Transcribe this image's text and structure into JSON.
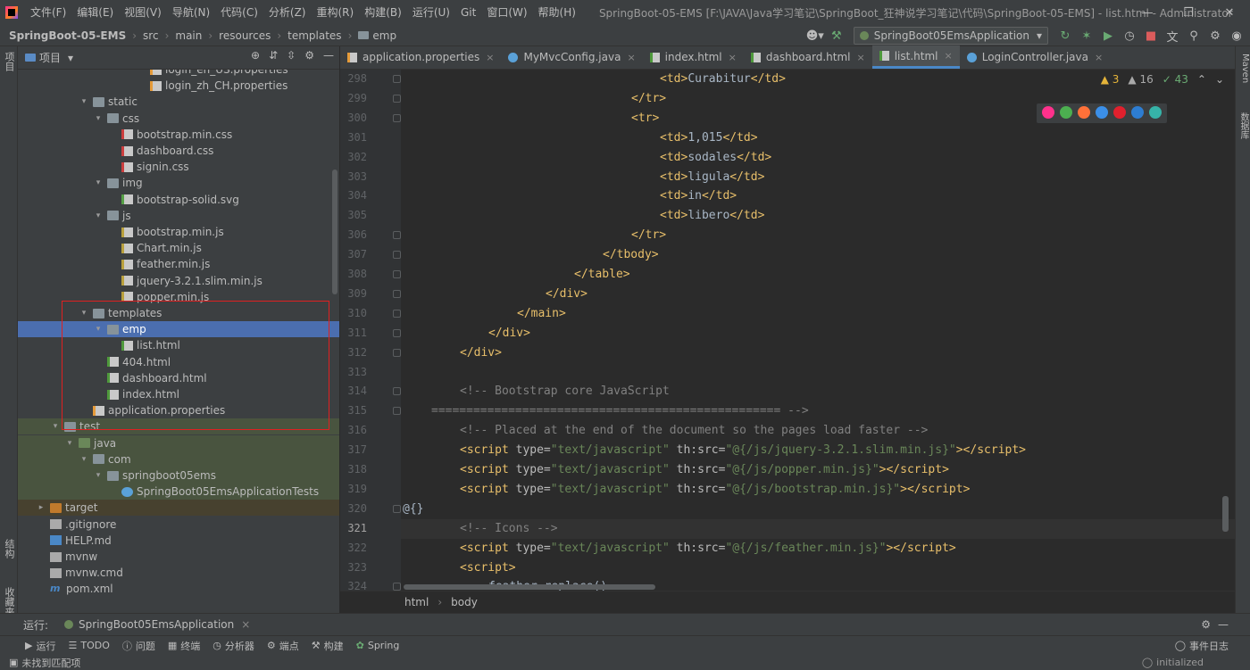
{
  "menu": {
    "items": [
      "文件(F)",
      "编辑(E)",
      "视图(V)",
      "导航(N)",
      "代码(C)",
      "分析(Z)",
      "重构(R)",
      "构建(B)",
      "运行(U)",
      "Git",
      "窗口(W)",
      "帮助(H)"
    ],
    "window_title": "SpringBoot-05-EMS [F:\\JAVA\\Java学习笔记\\SpringBoot_狂神说学习笔记\\代码\\SpringBoot-05-EMS] - list.html - Administrator"
  },
  "nav": {
    "breadcrumbs": [
      "SpringBoot-05-EMS",
      "src",
      "main",
      "resources",
      "templates",
      "emp"
    ],
    "run_config": "SpringBoot05EmsApplication"
  },
  "left_stripe": {
    "project": "项目",
    "structure": "结构",
    "favorites": "收藏夹"
  },
  "project_panel": {
    "title": "项目",
    "tree": [
      {
        "label": "login_en_US.properties",
        "type": "props"
      },
      {
        "label": "login_zh_CH.properties",
        "type": "props"
      },
      {
        "label": "static",
        "type": "folder",
        "expanded": true
      },
      {
        "label": "css",
        "type": "folder",
        "expanded": true
      },
      {
        "label": "bootstrap.min.css",
        "type": "css"
      },
      {
        "label": "dashboard.css",
        "type": "css"
      },
      {
        "label": "signin.css",
        "type": "css"
      },
      {
        "label": "img",
        "type": "folder",
        "expanded": true
      },
      {
        "label": "bootstrap-solid.svg",
        "type": "svg"
      },
      {
        "label": "js",
        "type": "folder",
        "expanded": true
      },
      {
        "label": "bootstrap.min.js",
        "type": "js"
      },
      {
        "label": "Chart.min.js",
        "type": "js"
      },
      {
        "label": "feather.min.js",
        "type": "js"
      },
      {
        "label": "jquery-3.2.1.slim.min.js",
        "type": "js"
      },
      {
        "label": "popper.min.js",
        "type": "js"
      },
      {
        "label": "templates",
        "type": "folder",
        "expanded": true
      },
      {
        "label": "emp",
        "type": "folder",
        "expanded": true,
        "selected": true
      },
      {
        "label": "list.html",
        "type": "html"
      },
      {
        "label": "404.html",
        "type": "html"
      },
      {
        "label": "dashboard.html",
        "type": "html"
      },
      {
        "label": "index.html",
        "type": "html"
      },
      {
        "label": "application.properties",
        "type": "props"
      },
      {
        "label": "test",
        "type": "folder",
        "expanded": true
      },
      {
        "label": "java",
        "type": "folder-green",
        "expanded": true
      },
      {
        "label": "com",
        "type": "folder",
        "expanded": true
      },
      {
        "label": "springboot05ems",
        "type": "folder",
        "expanded": true
      },
      {
        "label": "SpringBoot05EmsApplicationTests",
        "type": "test"
      },
      {
        "label": "target",
        "type": "folder-orange",
        "expanded": false
      },
      {
        "label": ".gitignore",
        "type": "file"
      },
      {
        "label": "HELP.md",
        "type": "md"
      },
      {
        "label": "mvnw",
        "type": "file"
      },
      {
        "label": "mvnw.cmd",
        "type": "file"
      },
      {
        "label": "pom.xml",
        "type": "m"
      }
    ]
  },
  "tabs": [
    {
      "label": "application.properties",
      "icon": "props"
    },
    {
      "label": "MyMvcConfig.java",
      "icon": "java"
    },
    {
      "label": "index.html",
      "icon": "html"
    },
    {
      "label": "dashboard.html",
      "icon": "html"
    },
    {
      "label": "list.html",
      "icon": "html",
      "active": true
    },
    {
      "label": "LoginController.java",
      "icon": "java"
    }
  ],
  "inspections": {
    "warnings": "3",
    "weak": "16",
    "ok": "43"
  },
  "editor": {
    "current_line": "321",
    "lines": [
      {
        "n": "298",
        "html": "                <span class='tag'>&lt;td&gt;</span>Curabitur<span class='tag'>&lt;/td&gt;</span>"
      },
      {
        "n": "299",
        "html": "            <span class='tag'>&lt;/tr&gt;</span>"
      },
      {
        "n": "300",
        "html": "            <span class='tag'>&lt;tr&gt;</span>"
      },
      {
        "n": "301",
        "html": "                <span class='tag'>&lt;td&gt;</span>1,015<span class='tag'>&lt;/td&gt;</span>"
      },
      {
        "n": "302",
        "html": "                <span class='tag'>&lt;td&gt;</span>sodales<span class='tag'>&lt;/td&gt;</span>"
      },
      {
        "n": "303",
        "html": "                <span class='tag'>&lt;td&gt;</span>ligula<span class='tag'>&lt;/td&gt;</span>"
      },
      {
        "n": "304",
        "html": "                <span class='tag'>&lt;td&gt;</span>in<span class='tag'>&lt;/td&gt;</span>"
      },
      {
        "n": "305",
        "html": "                <span class='tag'>&lt;td&gt;</span>libero<span class='tag'>&lt;/td&gt;</span>"
      },
      {
        "n": "306",
        "html": "            <span class='tag'>&lt;/tr&gt;</span>"
      },
      {
        "n": "307",
        "html": "        <span class='tag'>&lt;/tbody&gt;</span>"
      },
      {
        "n": "308",
        "html": "    <span class='tag'>&lt;/table&gt;</span>"
      },
      {
        "n": "309",
        "html": "<span class='tag'>&lt;/div&gt;</span>"
      },
      {
        "n": "310",
        "html": "<span class='tag'>&lt;/main&gt;</span>"
      },
      {
        "n": "311",
        "html": "<span class='tag'>&lt;/div&gt;</span>"
      },
      {
        "n": "312",
        "html": "<span class='tag'>&lt;/div&gt;</span>"
      },
      {
        "n": "313",
        "html": ""
      },
      {
        "n": "314",
        "html": "<span class='cmt'>&lt;!-- Bootstrap core JavaScript</span>"
      },
      {
        "n": "315",
        "html": "<span class='cmt'>================================================== --&gt;</span>"
      },
      {
        "n": "316",
        "html": "<span class='cmt'>&lt;!-- Placed at the end of the document so the pages load faster --&gt;</span>"
      },
      {
        "n": "317",
        "html": "<span class='tag'>&lt;script </span><span class='attr'>type=</span><span class='str'>\"text/javascript\"</span> <span class='attr'>th:src=</span><span class='str'>\"@{/js/jquery-3.2.1.slim.min.js}\"</span><span class='tag'>&gt;&lt;/script&gt;</span>"
      },
      {
        "n": "318",
        "html": "<span class='tag'>&lt;script </span><span class='attr'>type=</span><span class='str'>\"text/javascript\"</span> <span class='attr'>th:src=</span><span class='str'>\"@{/js/popper.min.js}\"</span><span class='tag'>&gt;&lt;/script&gt;</span>"
      },
      {
        "n": "319",
        "html": "<span class='tag'>&lt;script </span><span class='attr'>type=</span><span class='str'>\"text/javascript\"</span> <span class='attr'>th:src=</span><span class='str'>\"@{/js/bootstrap.min.js}\"</span><span class='tag'>&gt;&lt;/script&gt;</span>"
      },
      {
        "n": "320",
        "html": "@{}"
      },
      {
        "n": "321",
        "html": ""
      },
      {
        "n": "322",
        "html": "<span class='cmt'>&lt;!-- Icons --&gt;</span>"
      },
      {
        "n": "322b",
        "html": "<span class='tag'>&lt;script </span><span class='attr'>type=</span><span class='str'>\"text/javascript\"</span> <span class='attr'>th:src=</span><span class='str'>\"@{/js/feather.min.js}\"</span><span class='tag'>&gt;&lt;/script&gt;</span>"
      },
      {
        "n": "323",
        "html": "<span class='tag'>&lt;script&gt;</span>"
      },
      {
        "n": "324",
        "html": "    feather.replace()"
      }
    ]
  },
  "code_crumbs": [
    "html",
    "body"
  ],
  "right_stripe": {
    "maven": "Maven",
    "database": "数据库"
  },
  "runbar": {
    "label": "运行:",
    "tab": "SpringBoot05EmsApplication"
  },
  "tool_windows": [
    "运行",
    "TODO",
    "问题",
    "终端",
    "分析器",
    "端点",
    "构建",
    "Spring"
  ],
  "event_log": "事件日志",
  "status": {
    "left": "未找到匹配项",
    "right": "initialized"
  }
}
